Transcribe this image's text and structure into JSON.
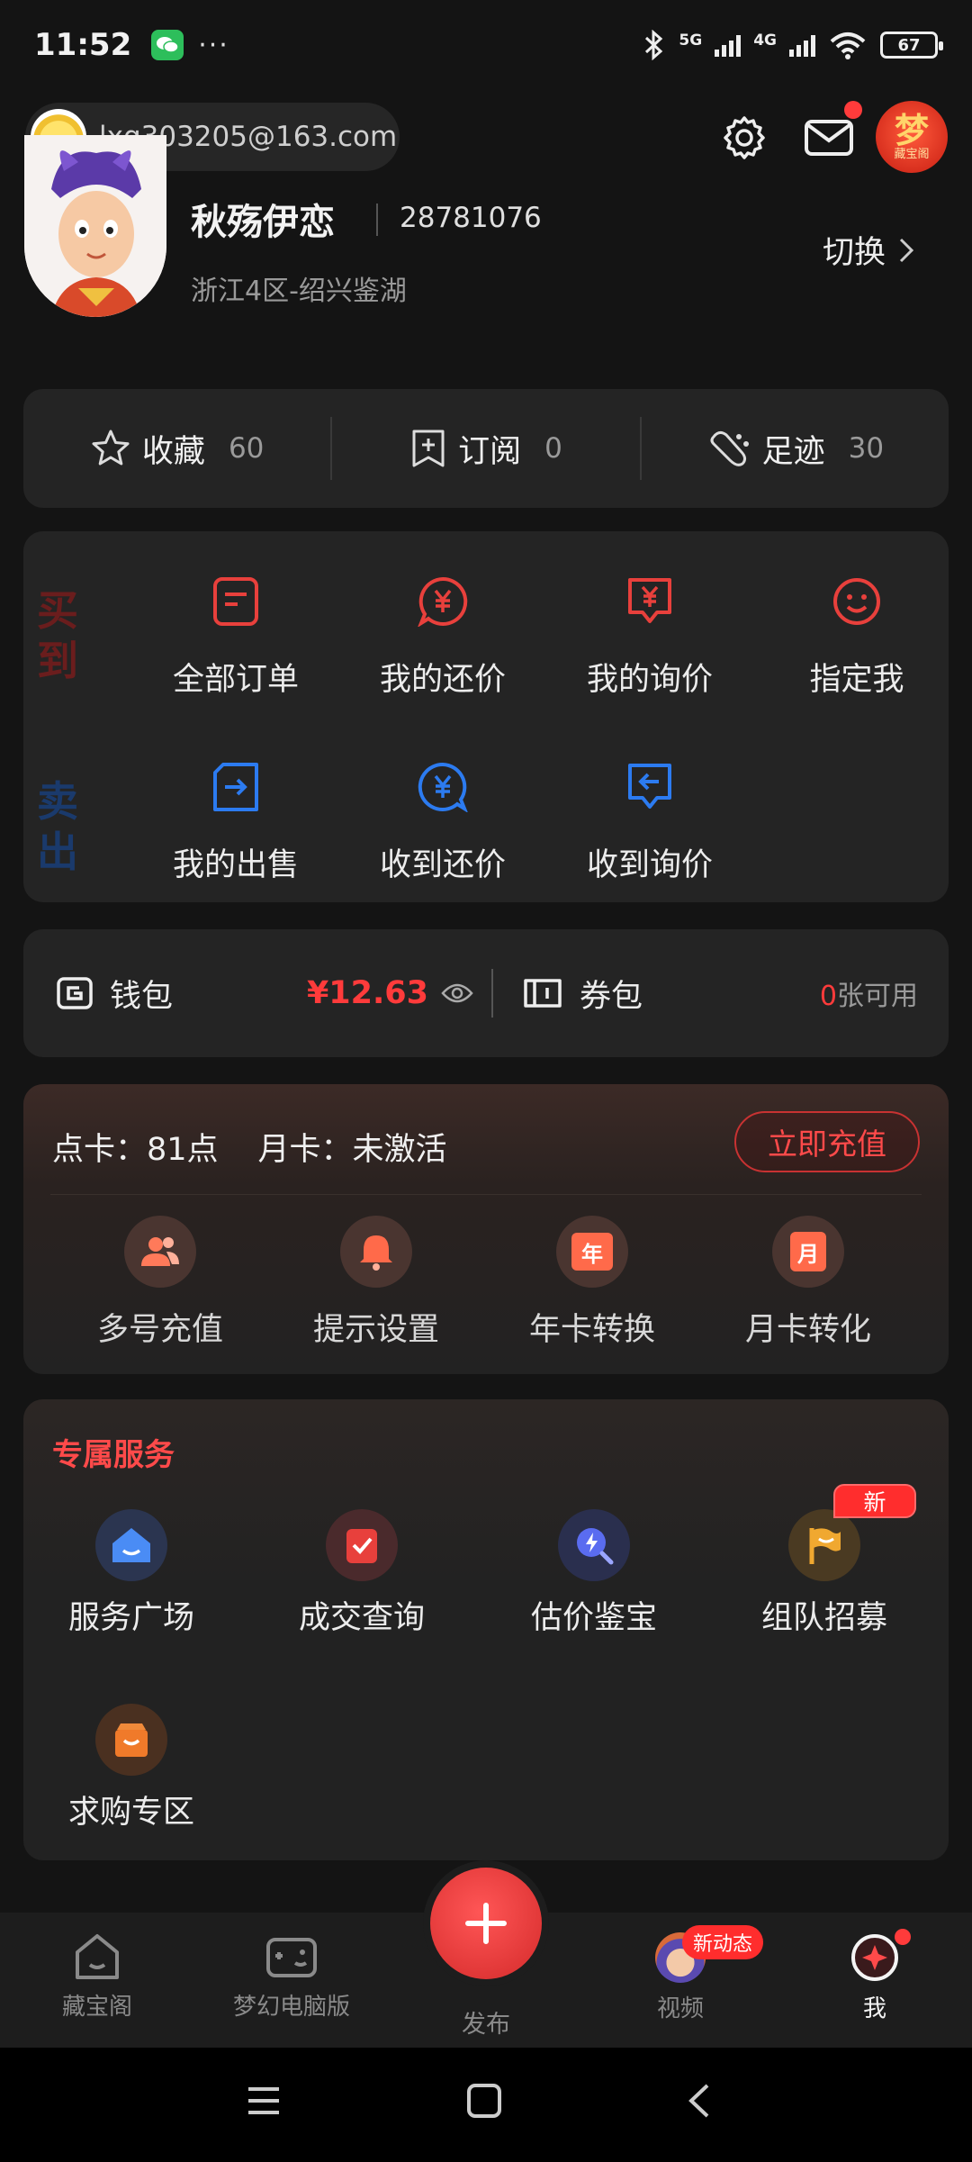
{
  "status_bar": {
    "time": "11:52",
    "dots": "···",
    "net1": "5G",
    "net2": "4G",
    "battery": "67"
  },
  "account": {
    "email": "lxq303205@163.com"
  },
  "brand": {
    "big": "梦",
    "small": "藏宝阁"
  },
  "profile": {
    "name": "秋殇伊恋",
    "id": "28781076",
    "server": "浙江4区-绍兴鉴湖",
    "switch_label": "切换"
  },
  "stats": [
    {
      "label": "收藏",
      "count": "60"
    },
    {
      "label": "订阅",
      "count": "0"
    },
    {
      "label": "足迹",
      "count": "30"
    }
  ],
  "orders": {
    "buy_label": [
      "买",
      "到"
    ],
    "sell_label": [
      "卖",
      "出"
    ],
    "buy_items": [
      "全部订单",
      "我的还价",
      "我的询价",
      "指定我"
    ],
    "sell_items": [
      "我的出售",
      "收到还价",
      "收到询价"
    ]
  },
  "wallet": {
    "wallet_label": "钱包",
    "amount": "¥12.63",
    "coupon_label": "券包",
    "coupon_count": "0",
    "coupon_suffix": "张可用"
  },
  "recharge": {
    "point_card": "点卡：81点",
    "month_card": "月卡：未激活",
    "button": "立即充值",
    "items": [
      "多号充值",
      "提示设置",
      "年卡转换",
      "月卡转化"
    ],
    "year_icon_text": "年",
    "month_icon_text": "月"
  },
  "services": {
    "title": "专属服务",
    "items": [
      "服务广场",
      "成交查询",
      "估价鉴宝",
      "组队招募",
      "求购专区"
    ],
    "new_badge": "新"
  },
  "bottom_nav": {
    "items": [
      "藏宝阁",
      "梦幻电脑版",
      "视频",
      "我"
    ],
    "publish": "发布",
    "dynamic_badge": "新动态"
  },
  "colors": {
    "accent_red": "#ff3b3b",
    "buy_red": "#e8403c",
    "sell_blue": "#2c7bf0"
  }
}
